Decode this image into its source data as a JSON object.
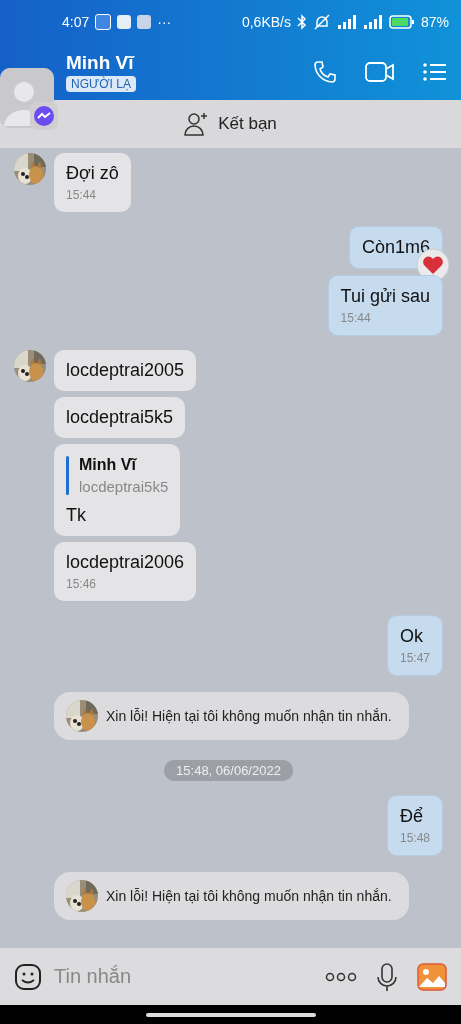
{
  "status_bar": {
    "time": "4:07",
    "more": "···",
    "speed": "0,6KB/s",
    "battery": "87%"
  },
  "header": {
    "name": "Minh Vĩ",
    "badge": "NGƯỜI LẠ"
  },
  "friend_bar": {
    "label": "Kết bạn"
  },
  "messages": [
    {
      "kind": "in",
      "avatar": true,
      "text": "Đợi zô",
      "time": "15:44"
    },
    {
      "kind": "out",
      "text": "Còn1m6",
      "heart_reaction": true
    },
    {
      "kind": "out",
      "text": "Tui gửi sau",
      "time": "15:44"
    },
    {
      "kind": "in",
      "avatar": true,
      "text": "locdeptrai2005"
    },
    {
      "kind": "in",
      "avatar": false,
      "text": "locdeptrai5k5"
    },
    {
      "kind": "quote",
      "avatar": false,
      "quote_name": "Minh Vĩ",
      "quote_text": "locdeptrai5k5",
      "text": "Tk"
    },
    {
      "kind": "in",
      "avatar": false,
      "text": "locdeptrai2006",
      "time": "15:46"
    },
    {
      "kind": "out",
      "text": "Ok",
      "time": "15:47"
    },
    {
      "kind": "system",
      "text": "Xin lỗi! Hiện tại tôi không muốn nhận tin nhắn."
    },
    {
      "kind": "date",
      "text": "15:48, 06/06/2022"
    },
    {
      "kind": "out",
      "text": "Để",
      "time": "15:48"
    },
    {
      "kind": "system",
      "text": "Xin lỗi! Hiện tại tôi không muốn nhận tin nhắn."
    }
  ],
  "input": {
    "placeholder": "Tin nhắn"
  }
}
